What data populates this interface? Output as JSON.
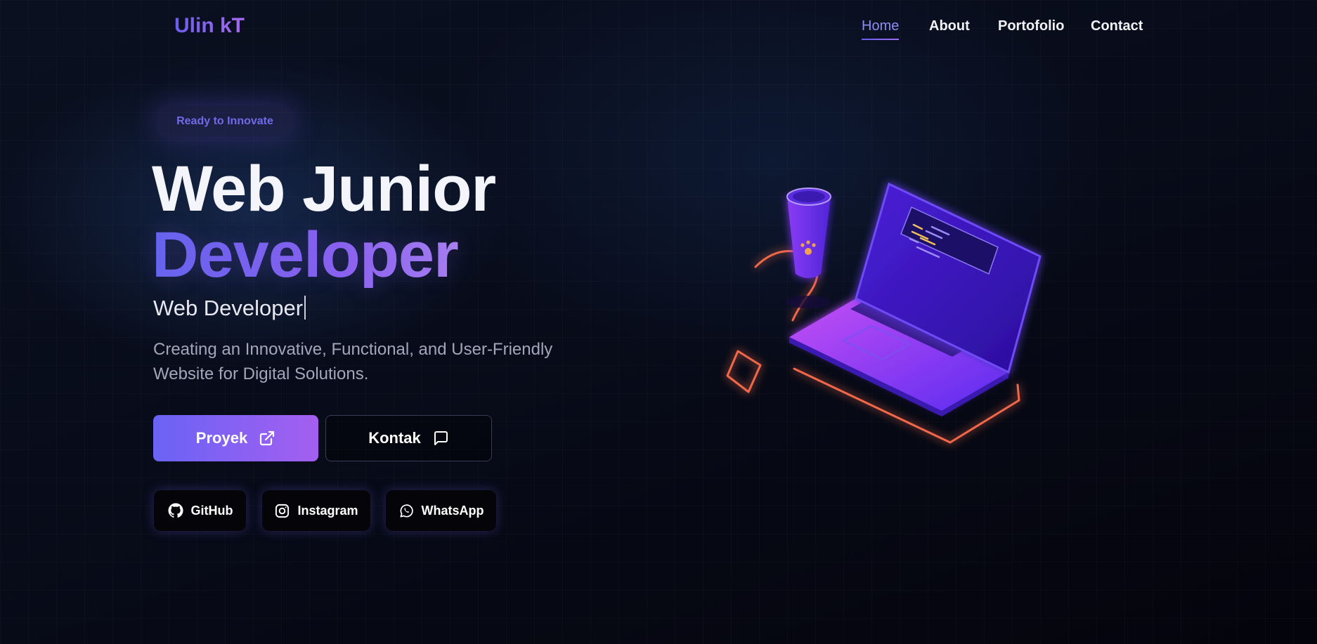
{
  "brand": {
    "logo": "Ulin kT"
  },
  "nav": {
    "items": [
      {
        "label": "Home",
        "active": true
      },
      {
        "label": "About",
        "active": false
      },
      {
        "label": "Portofolio",
        "active": false
      },
      {
        "label": "Contact",
        "active": false
      }
    ]
  },
  "hero": {
    "badge": "Ready to Innovate",
    "title_line1": "Web Junior",
    "title_line2": "Developer",
    "typed_text": "Web Developer",
    "description_line1": "Creating an Innovative, Functional, and User-Friendly",
    "description_line2": "Website for Digital Solutions.",
    "primary_button": {
      "label": "Proyek",
      "icon": "external-link-icon"
    },
    "secondary_button": {
      "label": "Kontak",
      "icon": "message-icon"
    }
  },
  "social": [
    {
      "label": "GitHub",
      "icon": "github-icon"
    },
    {
      "label": "Instagram",
      "icon": "instagram-icon"
    },
    {
      "label": "WhatsApp",
      "icon": "whatsapp-icon"
    }
  ],
  "colors": {
    "accent_start": "#6a63f5",
    "accent_end": "#a45ff0",
    "background": "#080c1a",
    "illustration_outline": "#f0684a"
  }
}
